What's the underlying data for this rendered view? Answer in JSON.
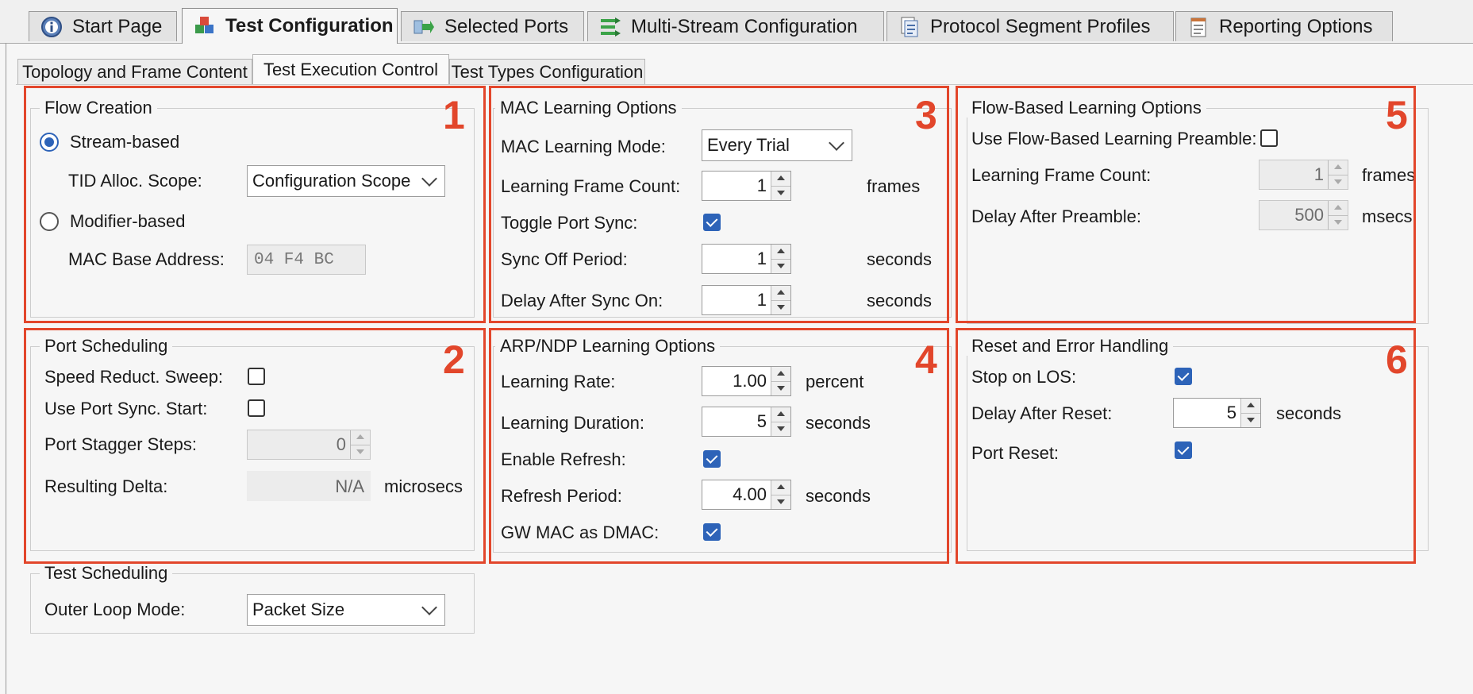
{
  "top_tabs": [
    {
      "label": "Start Page",
      "icon": "info-icon"
    },
    {
      "label": "Test Configuration",
      "icon": "cubes-icon"
    },
    {
      "label": "Selected Ports",
      "icon": "ports-arrow-icon"
    },
    {
      "label": "Multi-Stream Configuration",
      "icon": "multistream-icon"
    },
    {
      "label": "Protocol Segment Profiles",
      "icon": "document-icon"
    },
    {
      "label": "Reporting Options",
      "icon": "notepad-icon"
    }
  ],
  "sub_tabs": [
    {
      "label": "Topology and Frame Content"
    },
    {
      "label": "Test Execution Control"
    },
    {
      "label": "Test Types Configuration"
    }
  ],
  "annotation_color": "#e2462b",
  "accent_color": "#2d63b8",
  "flow_creation": {
    "title": "Flow Creation",
    "number": "1",
    "stream_based_label": "Stream-based",
    "stream_based_selected": true,
    "tid_scope_label": "TID Alloc. Scope:",
    "tid_scope_value": "Configuration Scope",
    "modifier_based_label": "Modifier-based",
    "modifier_based_selected": false,
    "mac_base_label": "MAC Base Address:",
    "mac_base_value": "04 F4 BC"
  },
  "port_scheduling": {
    "title": "Port Scheduling",
    "number": "2",
    "speed_sweep_label": "Speed Reduct. Sweep:",
    "speed_sweep_checked": false,
    "port_sync_label": "Use Port Sync. Start:",
    "port_sync_checked": false,
    "stagger_label": "Port Stagger Steps:",
    "stagger_value": "0",
    "delta_label": "Resulting Delta:",
    "delta_value": "N/A",
    "delta_unit": "microsecs"
  },
  "test_scheduling": {
    "title": "Test Scheduling",
    "outer_loop_label": "Outer Loop Mode:",
    "outer_loop_value": "Packet Size"
  },
  "mac_learning": {
    "title": "MAC Learning Options",
    "number": "3",
    "mode_label": "MAC Learning Mode:",
    "mode_value": "Every Trial",
    "frame_count_label": "Learning Frame Count:",
    "frame_count_value": "1",
    "frame_count_unit": "frames",
    "toggle_sync_label": "Toggle Port Sync:",
    "toggle_sync_checked": true,
    "sync_off_label": "Sync Off Period:",
    "sync_off_value": "1",
    "sync_off_unit": "seconds",
    "delay_sync_label": "Delay After Sync On:",
    "delay_sync_value": "1",
    "delay_sync_unit": "seconds"
  },
  "arp_learning": {
    "title": "ARP/NDP Learning Options",
    "number": "4",
    "rate_label": "Learning Rate:",
    "rate_value": "1.00",
    "rate_unit": "percent",
    "duration_label": "Learning Duration:",
    "duration_value": "5",
    "duration_unit": "seconds",
    "refresh_label": "Enable Refresh:",
    "refresh_checked": true,
    "refresh_period_label": "Refresh Period:",
    "refresh_period_value": "4.00",
    "refresh_period_unit": "seconds",
    "gw_mac_label": "GW MAC as DMAC:",
    "gw_mac_checked": true
  },
  "flow_learning": {
    "title": "Flow-Based Learning Options",
    "number": "5",
    "preamble_label": "Use Flow-Based Learning Preamble:",
    "preamble_checked": false,
    "frame_count_label": "Learning Frame Count:",
    "frame_count_value": "1",
    "frame_count_unit": "frames",
    "delay_label": "Delay After Preamble:",
    "delay_value": "500",
    "delay_unit": "msecs"
  },
  "reset_handling": {
    "title": "Reset and Error Handling",
    "number": "6",
    "stop_los_label": "Stop on LOS:",
    "stop_los_checked": true,
    "delay_reset_label": "Delay After Reset:",
    "delay_reset_value": "5",
    "delay_reset_unit": "seconds",
    "port_reset_label": "Port Reset:",
    "port_reset_checked": true
  }
}
